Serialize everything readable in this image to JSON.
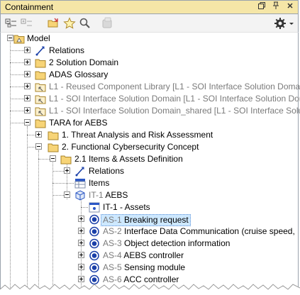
{
  "panel": {
    "title": "Containment",
    "controls": [
      "restore-icon",
      "pin-icon",
      "close-icon"
    ]
  },
  "toolbar": {
    "buttons": [
      "collapse-all-icon",
      "expand-all-icon",
      "open-folder-icon",
      "star-icon",
      "search-icon",
      "disabled-element-icon",
      "gear-icon",
      "dropdown-icon"
    ]
  },
  "tree": [
    {
      "label": "Model",
      "icon": "model-package-icon"
    },
    {
      "label": "Relations",
      "icon": "relations-icon"
    },
    {
      "label": "2 Solution Domain",
      "icon": "package-icon"
    },
    {
      "label": "ADAS Glossary",
      "icon": "package-icon"
    },
    {
      "label": "L1 - Reused Component Library [L1 - SOI Interface Solution Doma",
      "icon": "shared-package-icon"
    },
    {
      "label": "L1 - SOI Interface Solution Domain [L1 - SOI Interface Solution Dor",
      "icon": "shared-package-icon"
    },
    {
      "label": "L1 - SOI Interface Solution Domain_shared [L1 - SOI Interface Solut",
      "icon": "shared-package-icon"
    },
    {
      "label": "TARA for AEBS",
      "icon": "package-icon"
    },
    {
      "label": "1. Threat Analysis and Risk Assessment",
      "icon": "package-icon"
    },
    {
      "label": "2. Functional Cybersecurity Concept",
      "icon": "package-icon"
    },
    {
      "label": "2.1 Items & Assets Definition",
      "icon": "package-icon"
    },
    {
      "label": "Relations",
      "icon": "relations-icon"
    },
    {
      "label": "Items",
      "icon": "table-icon"
    },
    {
      "prefix": "IT-1",
      "label": "AEBS",
      "icon": "item-icon"
    },
    {
      "label": "IT-1 - Assets",
      "icon": "diagram-icon"
    },
    {
      "prefix": "AS-1",
      "label": "Breaking request",
      "icon": "asset-icon",
      "selected": true
    },
    {
      "prefix": "AS-2",
      "label": "Interface Data Communication (cruise speed,",
      "icon": "asset-icon"
    },
    {
      "prefix": "AS-3",
      "label": "Object detection information",
      "icon": "asset-icon"
    },
    {
      "prefix": "AS-4",
      "label": "AEBS controller",
      "icon": "asset-icon"
    },
    {
      "prefix": "AS-5",
      "label": "Sensing module",
      "icon": "asset-icon"
    },
    {
      "prefix": "AS-6",
      "label": "ACC controller",
      "icon": "asset-icon"
    }
  ]
}
